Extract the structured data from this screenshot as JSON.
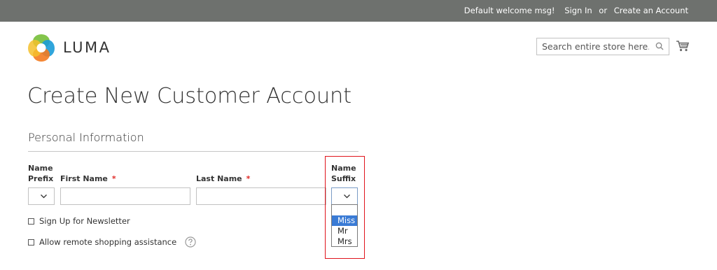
{
  "header": {
    "welcome": "Default welcome msg!",
    "sign_in": "Sign In",
    "or": "or",
    "create_account": "Create an Account"
  },
  "logo": {
    "text": "LUMA"
  },
  "search": {
    "placeholder": "Search entire store here...",
    "value": ""
  },
  "icons": {
    "search": "search-icon",
    "cart": "cart-icon",
    "chevron": "chevron-down-icon",
    "help": "question-mark-icon"
  },
  "page": {
    "title": "Create New Customer Account"
  },
  "section": {
    "title": "Personal Information"
  },
  "form": {
    "prefix_label_line1": "Name",
    "prefix_label_line2": "Prefix",
    "first_name_label": "First Name",
    "last_name_label": "Last Name",
    "required_mark": "*",
    "suffix_label_line1": "Name",
    "suffix_label_line2": "Suffix",
    "prefix_value": "",
    "first_name_value": "",
    "last_name_value": "",
    "suffix_value": "",
    "suffix_options": [
      "",
      "Miss",
      "Mr",
      "Mrs"
    ],
    "suffix_highlighted_option": "Miss",
    "newsletter_label": "Sign Up for Newsletter",
    "remote_assistance_label": "Allow remote shopping assistance"
  },
  "colors": {
    "topbar": "#6e716e",
    "required": "#e02b27",
    "highlight_box": "#e0141c",
    "option_selected": "#3a7bd5"
  }
}
